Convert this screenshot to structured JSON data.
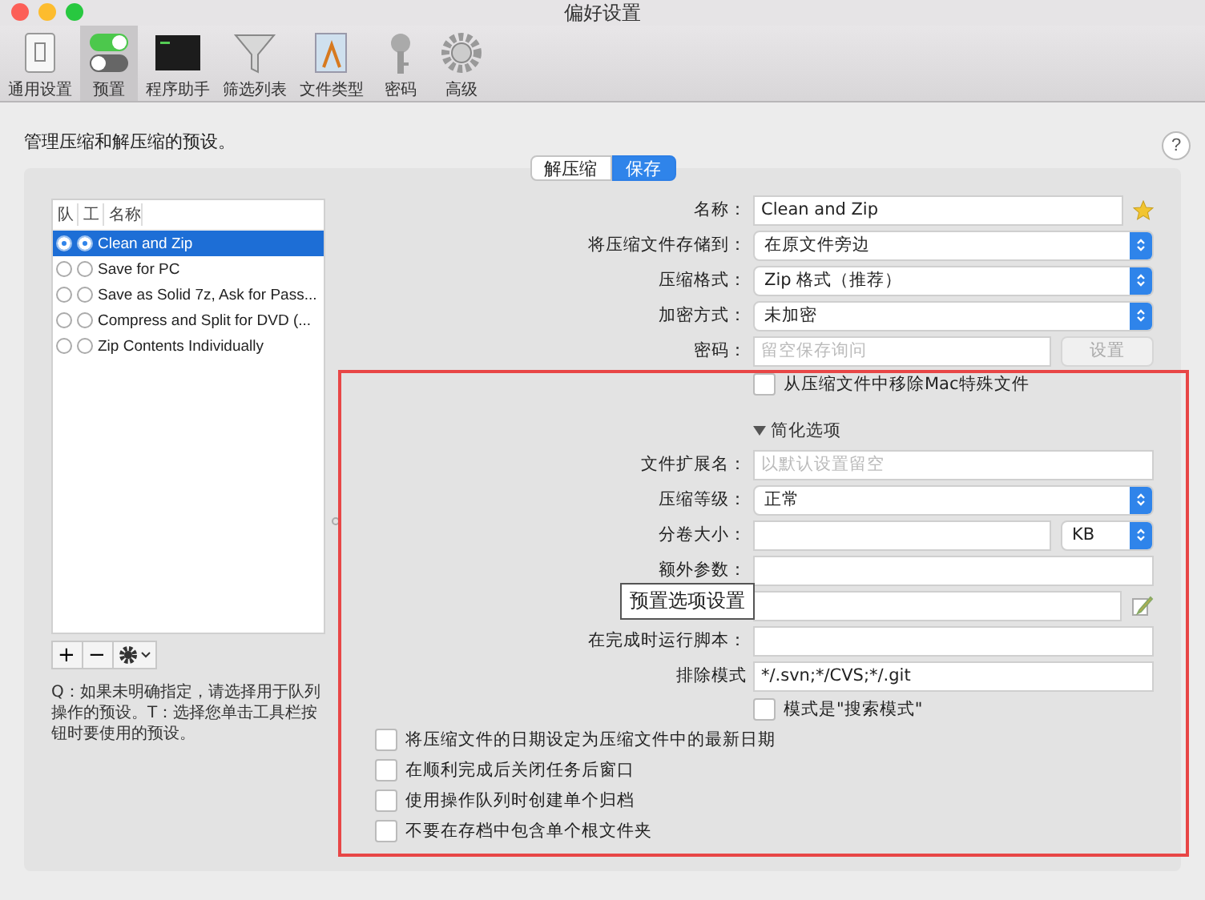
{
  "window": {
    "title": "偏好设置"
  },
  "toolbar": [
    {
      "label": "通用设置",
      "selected": false
    },
    {
      "label": "预置",
      "selected": true
    },
    {
      "label": "程序助手",
      "selected": false
    },
    {
      "label": "筛选列表",
      "selected": false
    },
    {
      "label": "文件类型",
      "selected": false
    },
    {
      "label": "密码",
      "selected": false
    },
    {
      "label": "高级",
      "selected": false
    }
  ],
  "description": "管理压缩和解压缩的预设。",
  "help": "?",
  "segments": [
    {
      "label": "解压缩",
      "selected": false
    },
    {
      "label": "保存",
      "selected": true
    }
  ],
  "presets": {
    "columns": [
      "队",
      "工",
      "名称"
    ],
    "rows": [
      {
        "name": "Clean and Zip",
        "q": true,
        "t": true,
        "selected": true
      },
      {
        "name": "Save for PC",
        "q": false,
        "t": false,
        "selected": false
      },
      {
        "name": "Save as Solid 7z, Ask for Pass...",
        "q": false,
        "t": false,
        "selected": false
      },
      {
        "name": "Compress and Split for DVD (...",
        "q": false,
        "t": false,
        "selected": false
      },
      {
        "name": "Zip Contents Individually",
        "q": false,
        "t": false,
        "selected": false
      }
    ],
    "buttons": [
      "+",
      "−"
    ],
    "note": "Q：如果未明确指定，请选择用于队列操作的预设。T：选择您单击工具栏按钮时要使用的预设。"
  },
  "form": [
    {
      "kind": "starred",
      "label": "名称：",
      "value": "Clean and Zip"
    },
    {
      "kind": "select",
      "label": "将压缩文件存储到：",
      "value": "在原文件旁边"
    },
    {
      "kind": "select",
      "label": "压缩格式：",
      "value": "Zip 格式（推荐）"
    },
    {
      "kind": "select",
      "label": "加密方式：",
      "value": "未加密"
    },
    {
      "kind": "password",
      "label": "密码：",
      "placeholder": "留空保存询问",
      "button": "设置",
      "disabled": true
    },
    {
      "kind": "checkbox",
      "label": "从压缩文件中移除Mac特殊文件",
      "checked": false
    },
    {
      "kind": "disclosure",
      "label": "简化选项",
      "expanded": true
    },
    {
      "kind": "text",
      "label": "文件扩展名：",
      "placeholder": "以默认设置留空"
    },
    {
      "kind": "select",
      "label": "压缩等级：",
      "value": "正常"
    },
    {
      "kind": "split",
      "label": "分卷大小：",
      "unit": "KB"
    },
    {
      "kind": "text",
      "label": "额外参数："
    },
    {
      "kind": "editable"
    },
    {
      "kind": "text",
      "label": "在完成时运行脚本："
    },
    {
      "kind": "text",
      "label": "排除模式",
      "value": "*/.svn;*/CVS;*/.git"
    },
    {
      "kind": "checkbox",
      "label": "模式是\"搜索模式\"",
      "checked": false
    },
    {
      "kind": "option",
      "label": "将压缩文件的日期设定为压缩文件中的最新日期",
      "checked": false
    },
    {
      "kind": "option",
      "label": "在顺利完成后关闭任务后窗口",
      "checked": false
    },
    {
      "kind": "option",
      "label": "使用操作队列时创建单个归档",
      "checked": false
    },
    {
      "kind": "option",
      "label": "不要在存档中包含单个根文件夹",
      "checked": false
    }
  ],
  "annotation": {
    "label": "预置选项设置"
  }
}
